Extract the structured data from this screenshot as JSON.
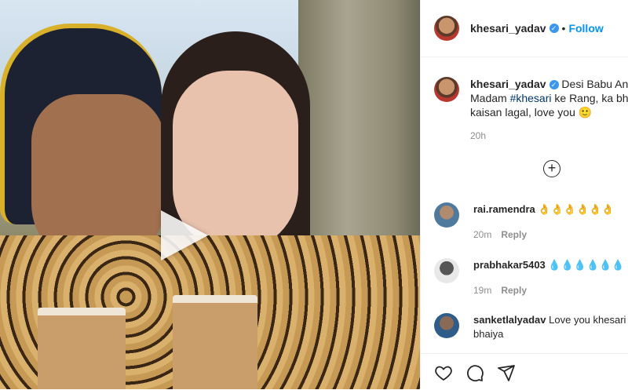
{
  "post": {
    "author": "khesari_yadav",
    "follow_label": "Follow",
    "dot": "•",
    "caption_line1_pre": "Desi Babu Ang",
    "caption_line2_pre": "Madam ",
    "caption_hashtag": "#khesari",
    "caption_line2_post": " ke Rang, ka bh",
    "caption_line3": "kaisan lagal, love you 🙂",
    "time": "20h",
    "load_more_icon": "plus-circle"
  },
  "comments": [
    {
      "user": "rai.ramendra",
      "text": "👌👌👌👌👌👌",
      "time": "20m",
      "reply": "Reply"
    },
    {
      "user": "prabhakar5403",
      "text": "💧💧💧💧💧💧",
      "time": "19m",
      "reply": "Reply"
    },
    {
      "user": "sanketlalyadav",
      "text": "Love you khesari",
      "text2": "bhaiya"
    }
  ],
  "icons": [
    "heart-icon",
    "comment-icon",
    "share-icon"
  ],
  "colors": {
    "follow": "#0095f6",
    "verified": "#3897f0"
  }
}
